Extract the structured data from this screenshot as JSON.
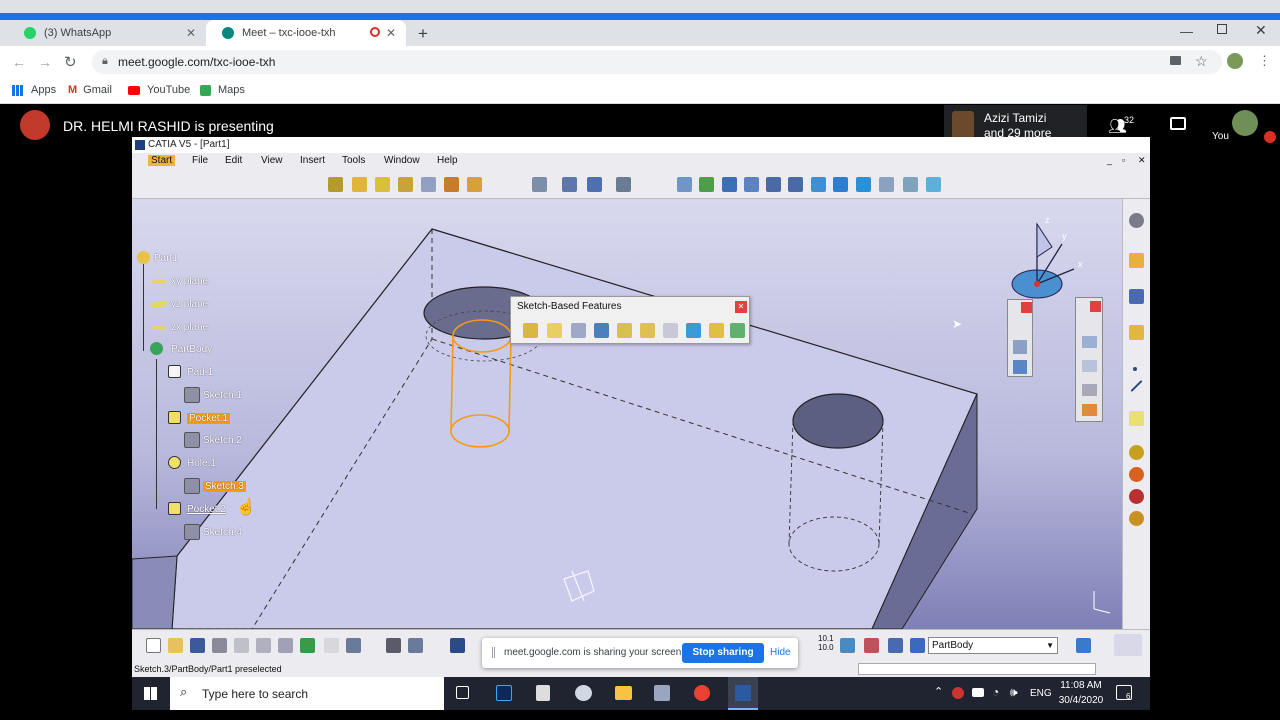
{
  "browser": {
    "tabs": [
      {
        "title": "(3) WhatsApp",
        "active": false,
        "fav_color": "#25d366"
      },
      {
        "title": "Meet – txc-iooe-txh",
        "active": true,
        "fav_color": "#00897b"
      }
    ],
    "new_tab_glyph": "+",
    "url": "meet.google.com/txc-iooe-txh",
    "bookmarks": [
      {
        "label": "Apps",
        "icon": "apps-grid-icon"
      },
      {
        "label": "Gmail",
        "icon": "gmail-icon"
      },
      {
        "label": "YouTube",
        "icon": "youtube-icon"
      },
      {
        "label": "Maps",
        "icon": "maps-icon"
      }
    ]
  },
  "meet": {
    "presenter_text": "DR. HELMI RASHID is presenting",
    "participant_name": "Azizi Tamizi",
    "participant_more": "and 29 more",
    "participant_count": "32",
    "self_label": "You",
    "share_banner_text": "meet.google.com is sharing your screen.",
    "stop_sharing": "Stop sharing",
    "hide": "Hide",
    "accent": "#1a73e8"
  },
  "catia": {
    "title": "CATIA V5 - [Part1]",
    "menu": [
      "Start",
      "File",
      "Edit",
      "View",
      "Insert",
      "Tools",
      "Window",
      "Help"
    ],
    "tree": [
      {
        "label": "Part1",
        "highlight": false
      },
      {
        "label": "xy plane",
        "highlight": false
      },
      {
        "label": "yz plane",
        "highlight": false
      },
      {
        "label": "zx plane",
        "highlight": false
      },
      {
        "label": "PartBody",
        "highlight": false
      },
      {
        "label": "Pad.1",
        "highlight": false
      },
      {
        "label": "Sketch.1",
        "highlight": false
      },
      {
        "label": "Pocket.1",
        "highlight": true
      },
      {
        "label": "Sketch.2",
        "highlight": false
      },
      {
        "label": "Hole.1",
        "highlight": false
      },
      {
        "label": "Sketch.3",
        "highlight": true
      },
      {
        "label": "Pocket.2",
        "highlight": false
      },
      {
        "label": "Sketch.4",
        "highlight": false
      }
    ],
    "floating_toolbar_title": "Sketch-Based Features",
    "compass_axes": [
      "x",
      "y",
      "z"
    ],
    "status": "Sketch.3/PartBody/Part1 preselected",
    "body_select": "PartBody",
    "highlight_color": "#f39c12",
    "ruler_label": "10.1\n10.0"
  },
  "taskbar": {
    "search_placeholder": "Type here to search",
    "language": "ENG",
    "time": "11:08 AM",
    "date": "30/4/2020",
    "notification_count": "6"
  }
}
